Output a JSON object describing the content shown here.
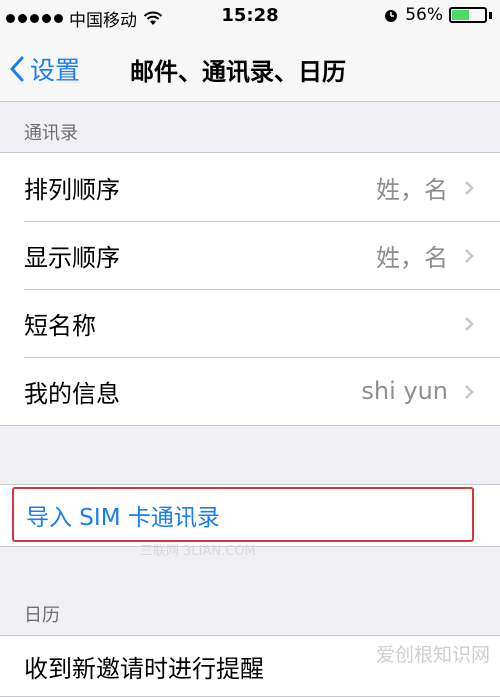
{
  "status": {
    "carrier": "中国移动",
    "time": "15:28",
    "battery_text": "56%",
    "battery_level": 0.56,
    "colors": {
      "battery": "#4cd964"
    }
  },
  "nav": {
    "back_label": "设置",
    "title": "邮件、通讯录、日历",
    "accent": "#1a7df0"
  },
  "contacts_section": {
    "header": "通讯录",
    "rows": [
      {
        "label": "排列顺序",
        "value": "姓，名"
      },
      {
        "label": "显示顺序",
        "value": "姓，名"
      },
      {
        "label": "短名称",
        "value": ""
      },
      {
        "label": "我的信息",
        "value": "shi yun"
      }
    ]
  },
  "import_sim": {
    "label": "导入 SIM 卡通讯录"
  },
  "calendar_section": {
    "header": "日历",
    "rows": [
      {
        "label": "收到新邀请时进行提醒"
      }
    ]
  },
  "watermarks": {
    "small": "三联网 3LIAN.COM",
    "corner": "爱创根知识网"
  }
}
